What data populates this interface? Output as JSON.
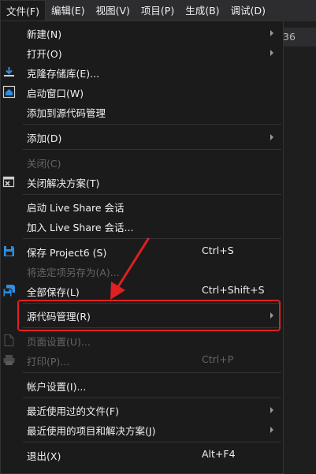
{
  "menubar": {
    "items": [
      {
        "label": "文件(F)"
      },
      {
        "label": "编辑(E)"
      },
      {
        "label": "视图(V)"
      },
      {
        "label": "项目(P)"
      },
      {
        "label": "生成(B)"
      },
      {
        "label": "调试(D)"
      }
    ]
  },
  "background_tab": {
    "label": "36"
  },
  "file_menu": {
    "new": {
      "label": "新建(N)"
    },
    "open": {
      "label": "打开(O)"
    },
    "clone_repo": {
      "label": "克隆存储库(E)..."
    },
    "start_window": {
      "label": "启动窗口(W)"
    },
    "add_to_source_control": {
      "label": "添加到源代码管理"
    },
    "add": {
      "label": "添加(D)"
    },
    "close": {
      "label": "关闭(C)"
    },
    "close_solution": {
      "label": "关闭解决方案(T)"
    },
    "start_live_share": {
      "label": "启动 Live Share 会话"
    },
    "join_live_share": {
      "label": "加入 Live Share 会话..."
    },
    "save_project": {
      "label": "保存 Project6 (S)",
      "shortcut": "Ctrl+S"
    },
    "save_selected_as": {
      "label": "将选定项另存为(A)..."
    },
    "save_all": {
      "label": "全部保存(L)",
      "shortcut": "Ctrl+Shift+S"
    },
    "source_control": {
      "label": "源代码管理(R)"
    },
    "page_setup": {
      "label": "页面设置(U)..."
    },
    "print": {
      "label": "打印(P)...",
      "shortcut": "Ctrl+P"
    },
    "account_settings": {
      "label": "帐户设置(I)..."
    },
    "recent_files": {
      "label": "最近使用过的文件(F)"
    },
    "recent_projects": {
      "label": "最近使用的项目和解决方案(J)"
    },
    "exit": {
      "label": "退出(X)",
      "shortcut": "Alt+F4"
    }
  },
  "colors": {
    "menu_background": "#1b1b1c",
    "menubar_background": "#2d2d30",
    "text": "#f1f1f1",
    "disabled_text": "#656565",
    "icon_blue": "#2c8ee2",
    "annotation_red": "#e02020"
  }
}
